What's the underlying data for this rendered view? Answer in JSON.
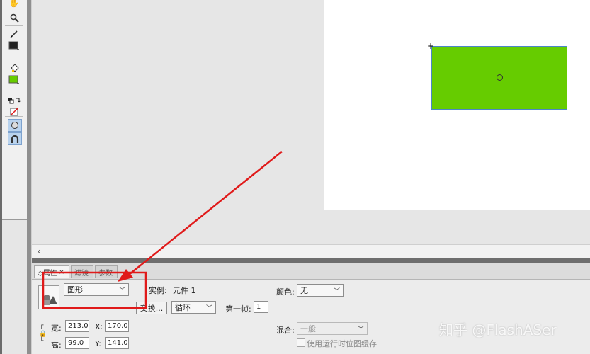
{
  "panel": {
    "tabs": [
      {
        "label": "◇属性",
        "close": "×"
      },
      {
        "label": "滤镜"
      },
      {
        "label": "参数"
      }
    ],
    "type_dropdown": "图形",
    "instance_label": "实例:",
    "instance_value": "元件 1",
    "swap_button": "交换...",
    "loop_dropdown": "循环",
    "first_frame_label": "第一帧:",
    "first_frame_value": "1",
    "color_label": "颜色:",
    "color_dropdown": "无",
    "width_label": "宽:",
    "width_value": "213.0",
    "height_label": "高:",
    "height_value": "99.0",
    "x_label": "X:",
    "x_value": "170.0",
    "y_label": "Y:",
    "y_value": "141.0",
    "blend_label": "混合:",
    "blend_dropdown": "一般",
    "cache_checkbox_label": "使用运行时位图缓存"
  },
  "stage": {
    "shape_color": "#66cc00",
    "shape_border": "#4b86c8"
  },
  "watermark": "知乎 @FlashASer",
  "annotation_color": "#e01a1a",
  "icons": [
    "hand-icon",
    "zoom-icon",
    "pencil-icon",
    "stroke-color-icon",
    "paint-bucket-icon",
    "fill-color-icon",
    "swap-colors-icon",
    "no-color-icon",
    "object-drawing-icon",
    "snap-magnet-icon"
  ]
}
